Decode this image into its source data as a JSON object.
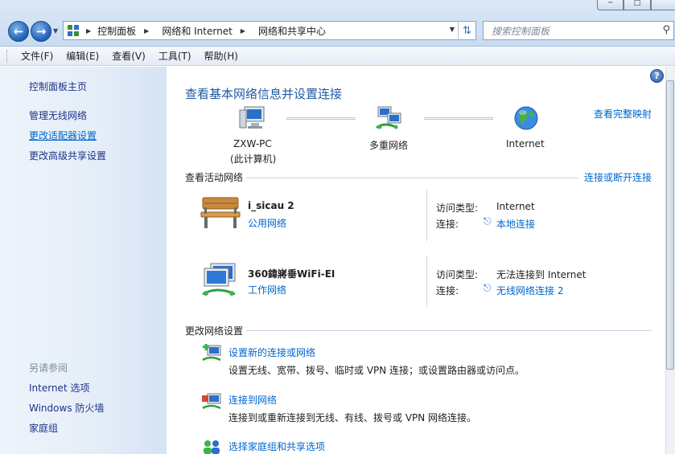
{
  "address": {
    "crumbs": [
      "控制面板",
      "网络和 Internet",
      "网络和共享中心"
    ]
  },
  "search": {
    "placeholder": "搜索控制面板"
  },
  "menu": [
    "文件(F)",
    "编辑(E)",
    "查看(V)",
    "工具(T)",
    "帮助(H)"
  ],
  "sidebar": {
    "items": [
      "控制面板主页",
      "管理无线网络",
      "更改适配器设置",
      "更改高级共享设置"
    ],
    "see_also_title": "另请参阅",
    "see_also": [
      "Internet 选项",
      "Windows 防火墙",
      "家庭组"
    ]
  },
  "main": {
    "title": "查看基本网络信息并设置连接",
    "full_map_link": "查看完整映射",
    "map": {
      "pc_name": "ZXW-PC",
      "pc_sub": "(此计算机)",
      "multi": "多重网络",
      "internet": "Internet"
    },
    "active_title": "查看活动网络",
    "connect_disconnect": "连接或断开连接",
    "access_type_label": "访问类型:",
    "connection_label": "连接:",
    "networks": [
      {
        "name": "i_sicau  2",
        "type": "公用网络",
        "access": "Internet",
        "connection": "本地连接"
      },
      {
        "name": "360鍏嶈垂WiFi-EI",
        "type": "工作网络",
        "access": "无法连接到 Internet",
        "connection": "无线网络连接 2"
      }
    ],
    "change_title": "更改网络设置",
    "tasks": [
      {
        "title": "设置新的连接或网络",
        "desc": "设置无线、宽带、拨号、临时或 VPN 连接；或设置路由器或访问点。"
      },
      {
        "title": "连接到网络",
        "desc": "连接到或重新连接到无线、有线、拨号或 VPN 网络连接。"
      },
      {
        "title": "选择家庭组和共享选项",
        "desc": ""
      }
    ]
  }
}
